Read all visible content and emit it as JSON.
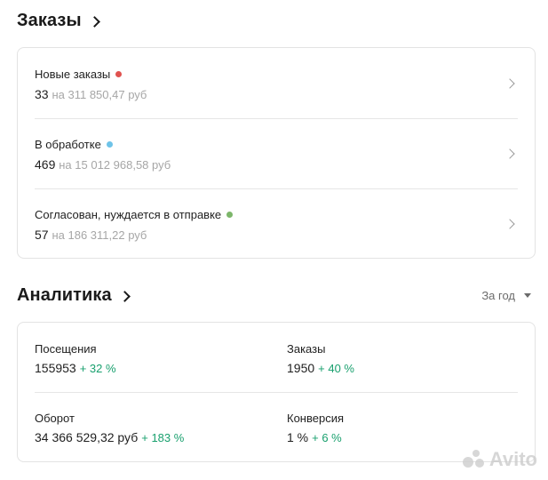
{
  "orders": {
    "title": "Заказы",
    "rows": [
      {
        "label": "Новые заказы",
        "dot_color": "#e0524f",
        "count": "33",
        "amount": "на 311 850,47 руб"
      },
      {
        "label": "В обработке",
        "dot_color": "#6ec3e8",
        "count": "469",
        "amount": "на 15 012 968,58 руб"
      },
      {
        "label": "Согласован, нуждается в отправке",
        "dot_color": "#7cb66a",
        "count": "57",
        "amount": "на 186 311,22 руб"
      }
    ]
  },
  "analytics": {
    "title": "Аналитика",
    "period": "За год",
    "metrics": [
      {
        "label": "Посещения",
        "value": "155953",
        "delta": "+ 32 %"
      },
      {
        "label": "Заказы",
        "value": "1950",
        "delta": "+ 40 %"
      },
      {
        "label": "Оборот",
        "value": "34 366 529,32 руб",
        "delta": "+ 183 %"
      },
      {
        "label": "Конверсия",
        "value": "1 %",
        "delta": "+ 6 %"
      }
    ]
  },
  "watermark": {
    "text": "Avito"
  },
  "icons": {
    "section_chevron": "chevron-right-icon",
    "row_chevron": "chevron-right-icon",
    "period_caret": "caret-down-icon"
  },
  "colors": {
    "positive_delta": "#19a06e",
    "muted_text": "#a6a6a6",
    "border": "#e3e3e3"
  }
}
